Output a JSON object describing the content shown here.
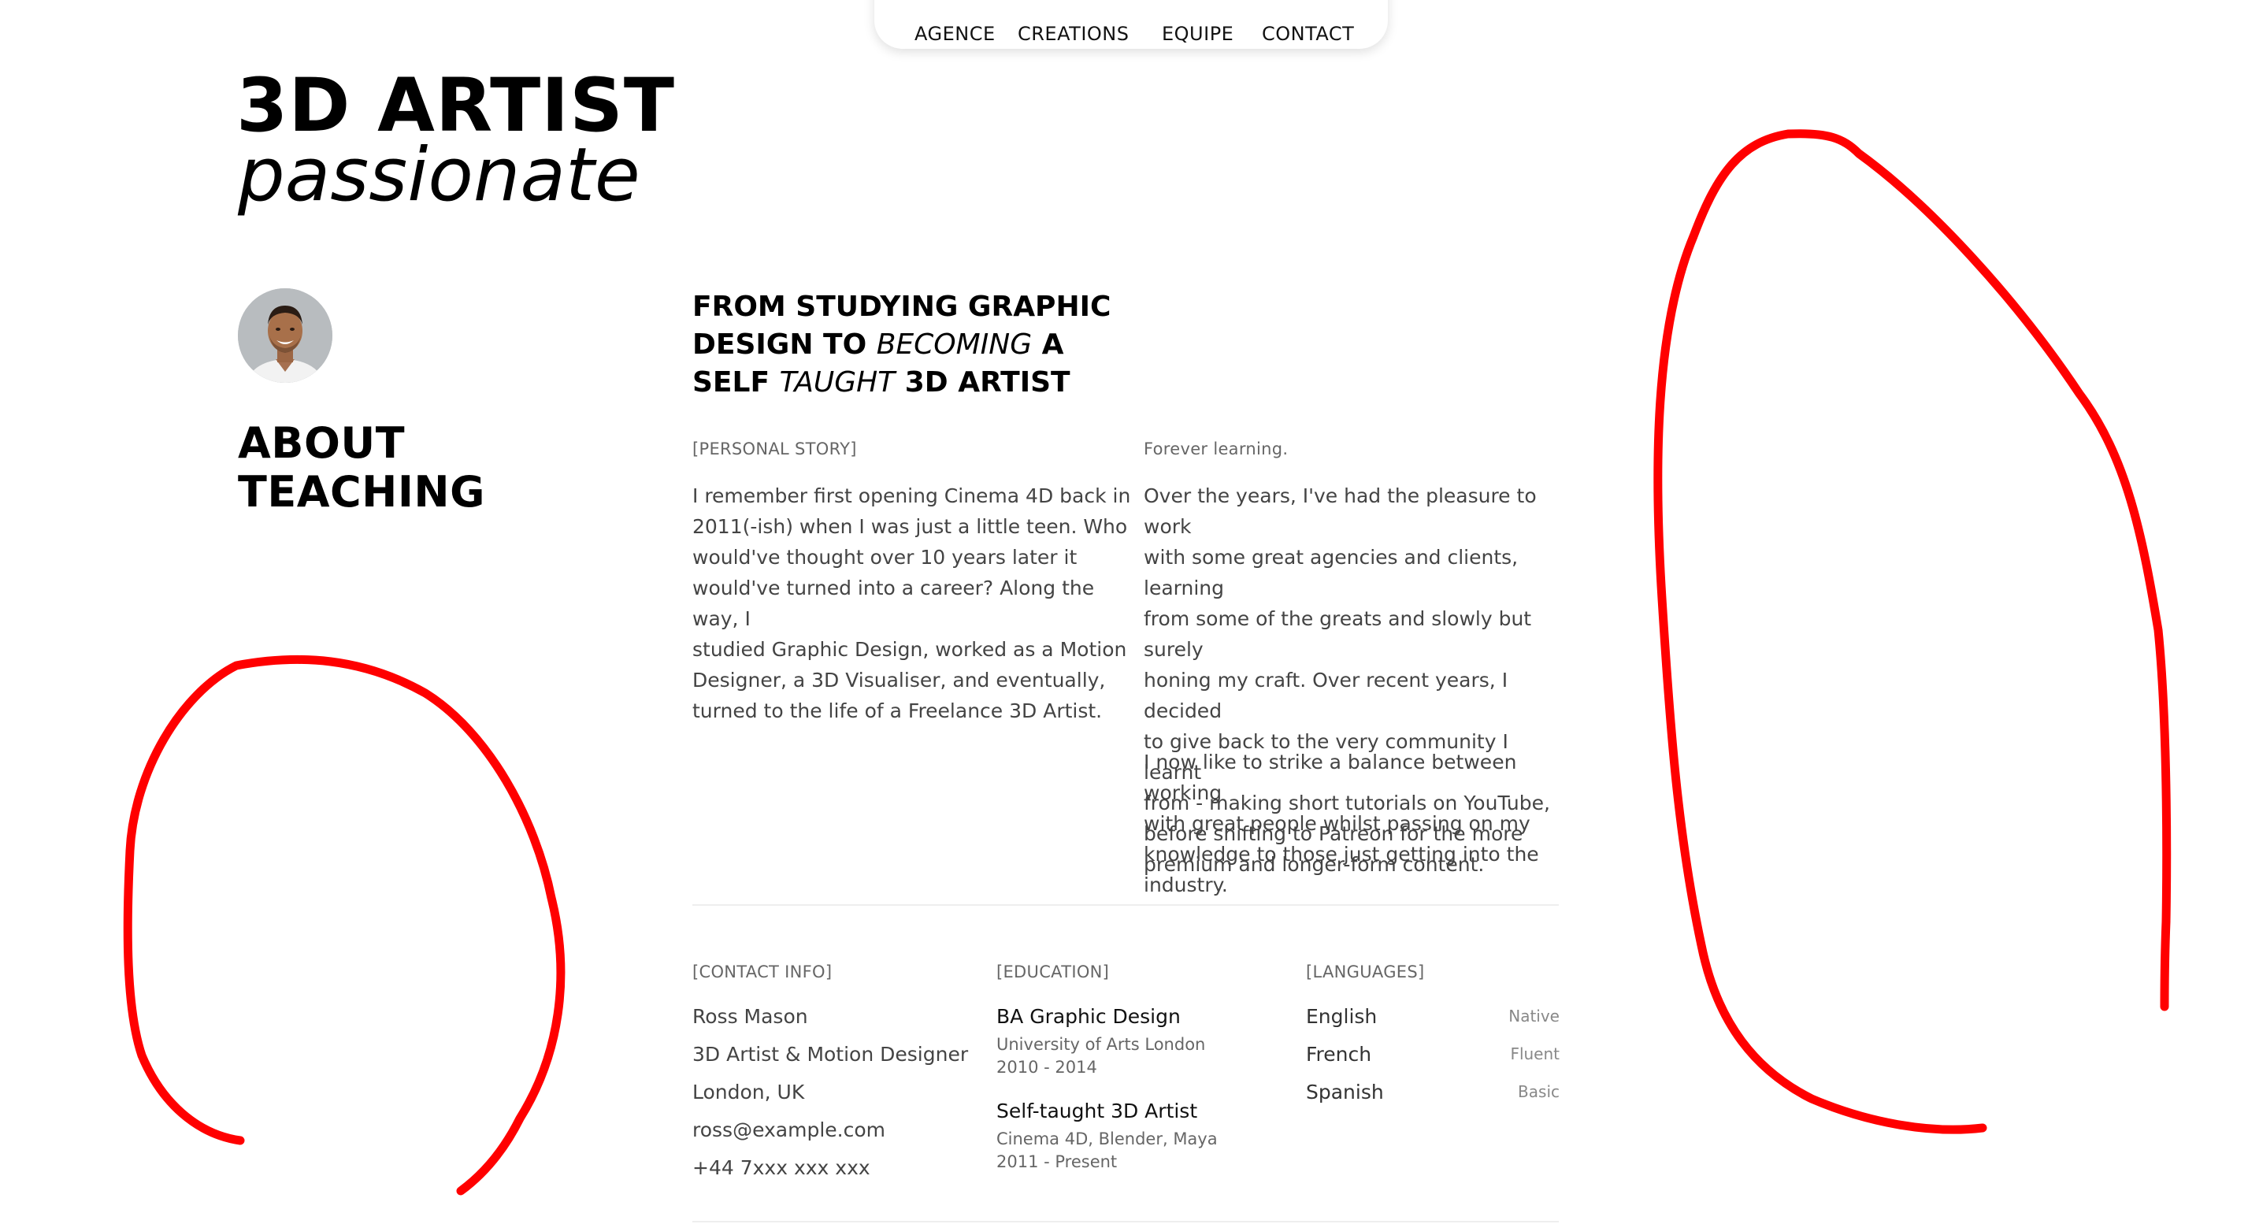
{
  "nav": {
    "items": [
      "AGENCE",
      "CREATIONS",
      "EQUIPE",
      "CONTACT"
    ]
  },
  "hero": {
    "title": "3D ARTIST",
    "subtitle": "passionate"
  },
  "about": {
    "heading_line1": "ABOUT",
    "heading_line2": "TEACHING"
  },
  "story": {
    "heading": {
      "line1": "FROM STUDYING GRAPHIC",
      "line2_a": "DESIGN TO ",
      "line2_b": "BECOMING",
      "line2_c": " A",
      "line3_a": "SELF ",
      "line3_b": "TAUGHT",
      "line3_c": " 3D ARTIST"
    },
    "left_label": "[PERSONAL STORY]",
    "left_lines": [
      "I remember first opening Cinema 4D back in",
      "2011(-ish) when I was just a little teen. Who",
      "would've thought over 10 years later it",
      "would've turned into a career? Along the way, I",
      "studied Graphic Design, worked as a Motion",
      "Designer, a 3D Visualiser, and eventually,",
      "turned to the life of a Freelance 3D Artist."
    ],
    "right_label": "Forever learning.",
    "right_lines_1": [
      "Over the years, I've had the pleasure to work",
      "with some great agencies and clients, learning",
      "from some of the greats and slowly but surely",
      "honing my craft. Over recent years, I decided",
      "to give back to the very community I learnt",
      "from - making short tutorials on YouTube,",
      "before shifting to Patreon for the more",
      "premium and longer-form content."
    ],
    "right_lines_2": [
      "I now like to strike a balance between working",
      "with great people whilst passing on my",
      "knowledge to those just getting into the",
      "industry."
    ]
  },
  "contact": {
    "label": "[CONTACT INFO]",
    "name": "Ross Mason",
    "role": "3D Artist & Motion Designer",
    "location": "London, UK",
    "email": "ross@example.com",
    "phone": "+44 7xxx xxx xxx"
  },
  "education": {
    "label": "[EDUCATION]",
    "items": [
      {
        "title": "BA Graphic Design",
        "school": "University of Arts London",
        "years": "2010 - 2014"
      },
      {
        "title": "Self-taught 3D Artist",
        "school": "Cinema 4D, Blender, Maya",
        "years": "2011 - Present"
      }
    ]
  },
  "languages": {
    "label": "[LANGUAGES]",
    "items": [
      {
        "name": "English",
        "level": "Native"
      },
      {
        "name": "French",
        "level": "Fluent"
      },
      {
        "name": "Spanish",
        "level": "Basic"
      }
    ]
  },
  "colors": {
    "annotation": "#ff0000"
  }
}
